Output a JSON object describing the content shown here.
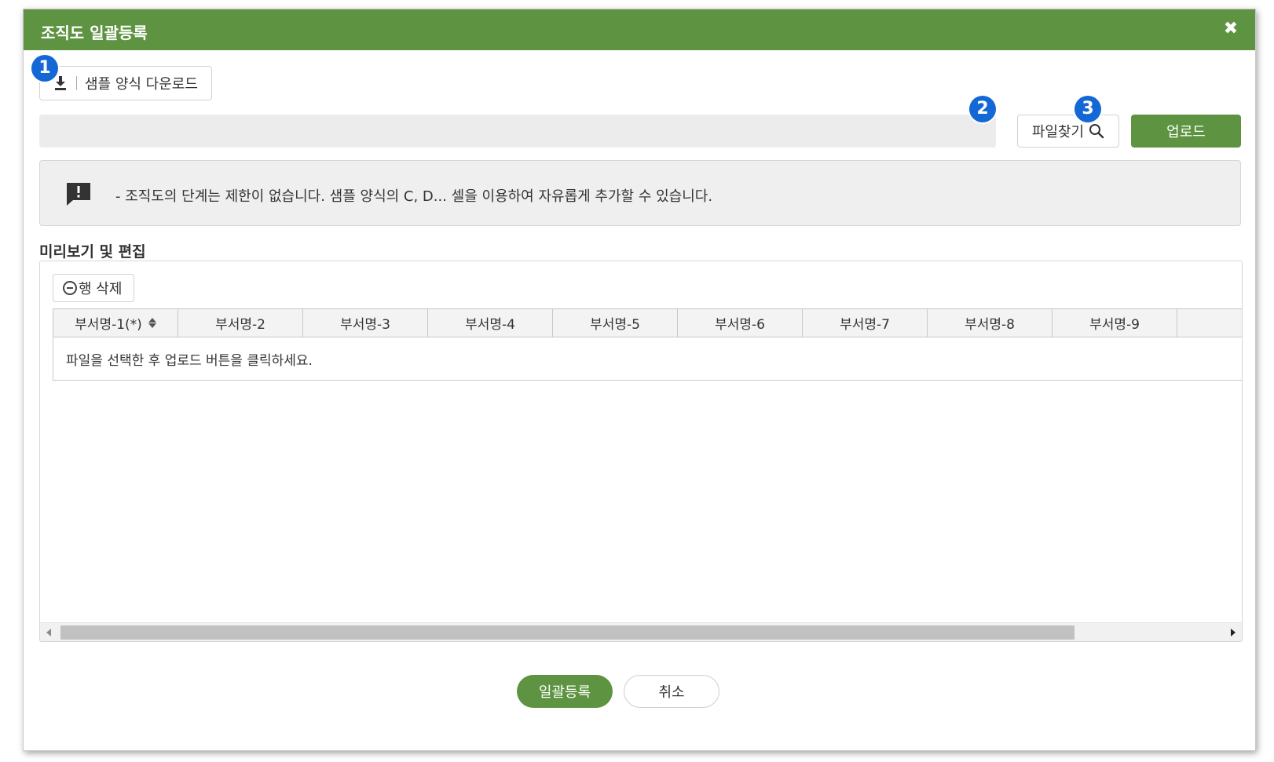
{
  "dialog": {
    "title": "조직도 일괄등록",
    "close_icon": "close-icon"
  },
  "markers": [
    "1",
    "2",
    "3"
  ],
  "toolbar": {
    "download_label": "샘플 양식 다운로드",
    "file_path_value": "",
    "find_label": "파일찾기",
    "upload_label": "업로드"
  },
  "notice": {
    "icon": "alert-comment-icon",
    "text": "- 조직도의 단계는 제한이 없습니다. 샘플 양식의 C, D... 셀을 이용하여 자유롭게 추가할 수 있습니다."
  },
  "preview": {
    "section_title": "미리보기 및 편집",
    "delete_row_label": "행 삭제",
    "columns": [
      "부서명-1(*)",
      "부서명-2",
      "부서명-3",
      "부서명-4",
      "부서명-5",
      "부서명-6",
      "부서명-7",
      "부서명-8",
      "부서명-9"
    ],
    "empty_message": "파일을 선택한 후 업로드 버튼을 클릭하세요."
  },
  "footer": {
    "confirm_label": "일괄등록",
    "cancel_label": "취소"
  },
  "colors": {
    "primary_green": "#5e9441",
    "marker_blue": "#1468d6"
  }
}
